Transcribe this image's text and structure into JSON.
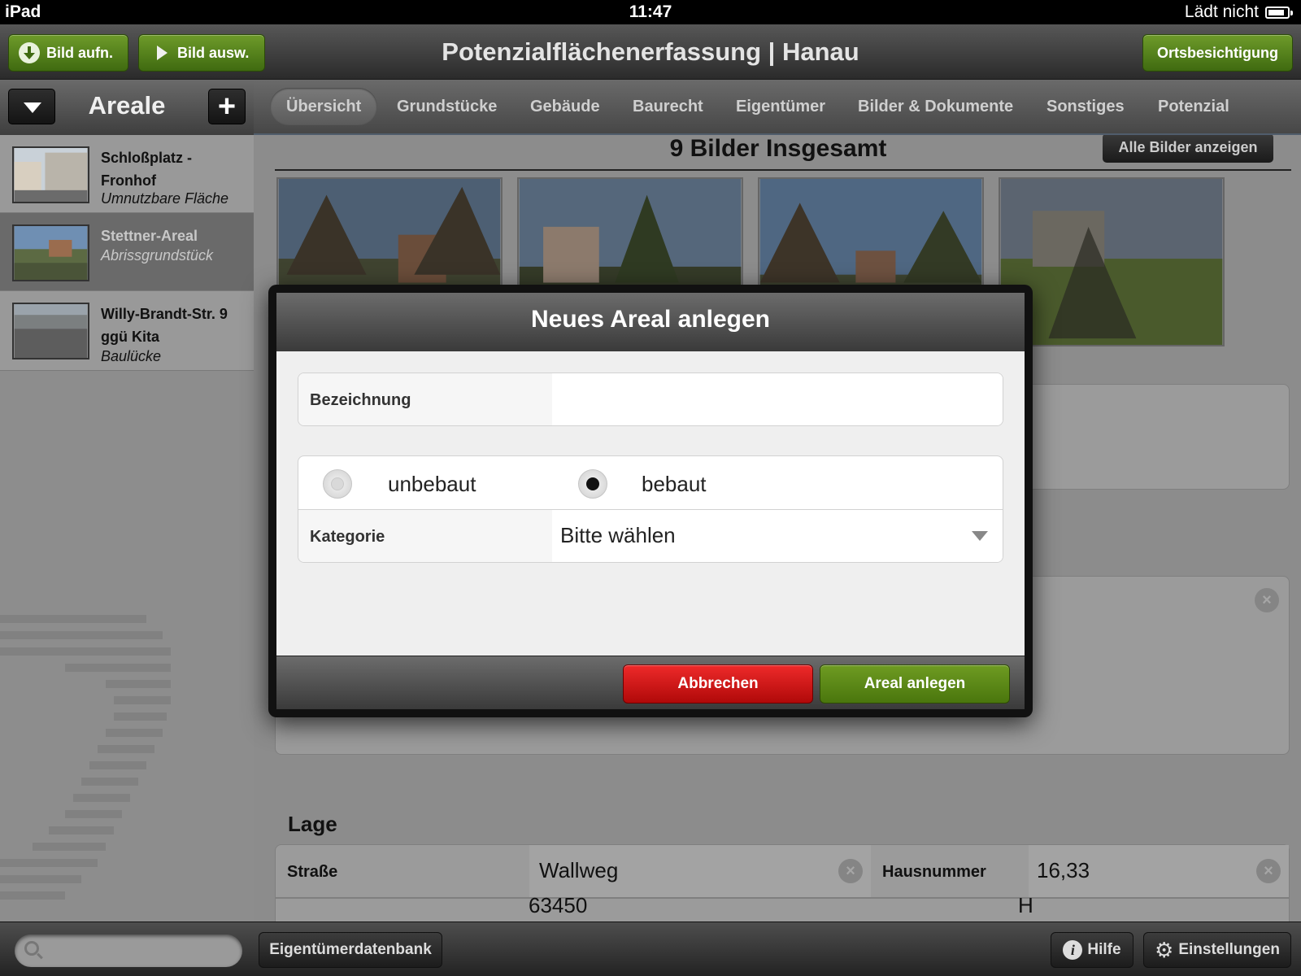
{
  "status_bar": {
    "device": "iPad",
    "time": "11:47",
    "charging": "Lädt nicht"
  },
  "toolbar": {
    "title": "Potenzialflächenerfassung | Hanau",
    "capture_image_label": "Bild aufn.",
    "select_image_label": "Bild ausw.",
    "site_visit_label": "Ortsbesichtigung"
  },
  "sidebar": {
    "title": "Areale",
    "items": [
      {
        "name": "Schloßplatz - Fronhof",
        "type": "Umnutzbare Fläche",
        "selected": false
      },
      {
        "name": "Stettner-Areal",
        "type": "Abrissgrundstück",
        "selected": true
      },
      {
        "name": "Willy-Brandt-Str. 9 ggü Kita",
        "type": "Baulücke",
        "selected": false
      }
    ]
  },
  "tabs": [
    {
      "label": "Übersicht",
      "active": true
    },
    {
      "label": "Grundstücke",
      "active": false
    },
    {
      "label": "Gebäude",
      "active": false
    },
    {
      "label": "Baurecht",
      "active": false
    },
    {
      "label": "Eigentümer",
      "active": false
    },
    {
      "label": "Bilder & Dokumente",
      "active": false
    },
    {
      "label": "Sonstiges",
      "active": false
    },
    {
      "label": "Potenzial",
      "active": false
    }
  ],
  "gallery": {
    "title": "9 Bilder Insgesamt",
    "show_all_label": "Alle Bilder anzeigen",
    "photos": [
      "photo-1",
      "photo-2",
      "photo-3",
      "photo-4"
    ]
  },
  "lage": {
    "title": "Lage",
    "street_label": "Straße",
    "street_value": "Wallweg",
    "house_number_label": "Hausnummer",
    "house_number_value": "16,33",
    "next_row_value_partial": "63450",
    "next_row_value2_partial": "H"
  },
  "modal": {
    "title": "Neues Areal anlegen",
    "name_label": "Bezeichnung",
    "name_value": "",
    "radio_options": [
      {
        "label": "unbebaut",
        "checked": false
      },
      {
        "label": "bebaut",
        "checked": true
      }
    ],
    "category_label": "Kategorie",
    "category_value": "Bitte wählen",
    "cancel_label": "Abbrechen",
    "create_label": "Areal anlegen"
  },
  "bottom_bar": {
    "search_placeholder": "",
    "owner_db_label": "Eigentümerdatenbank",
    "help_label": "Hilfe",
    "settings_label": "Einstellungen"
  },
  "colors": {
    "accent_green": "#4a760d",
    "cancel_red": "#d11414",
    "toolbar_dark": "#2b2b2b"
  },
  "icons": {
    "capture": "down-arrow-icon",
    "select": "play-icon",
    "dropdown": "chevron-down-icon",
    "add": "plus-icon",
    "clear": "clear-icon",
    "search": "search-icon",
    "help": "info-icon",
    "settings": "gear-icon",
    "battery": "battery-icon"
  }
}
